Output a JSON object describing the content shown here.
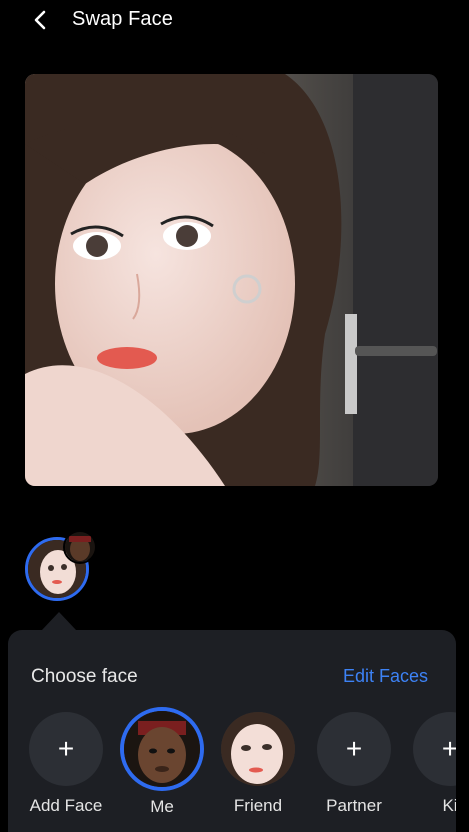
{
  "header": {
    "title": "Swap Face"
  },
  "panel": {
    "choose_label": "Choose face",
    "edit_label": "Edit Faces",
    "faces": [
      {
        "label": "Add Face",
        "kind": "add"
      },
      {
        "label": "Me",
        "kind": "photo",
        "selected": true
      },
      {
        "label": "Friend",
        "kind": "photo"
      },
      {
        "label": "Partner",
        "kind": "add"
      },
      {
        "label": "Ki",
        "kind": "add"
      }
    ]
  },
  "colors": {
    "accent": "#2e6bf0",
    "link": "#3d82f5",
    "panel_bg": "#1d1f24"
  }
}
